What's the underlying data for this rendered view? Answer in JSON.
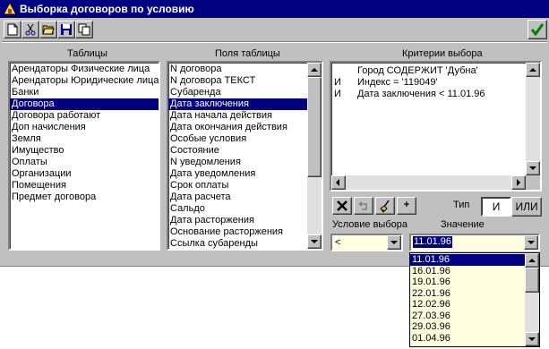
{
  "window": {
    "title": "Выборка договоров по условию"
  },
  "toolbar": {
    "icons": [
      "new-icon",
      "cut-icon",
      "open-icon",
      "save-icon",
      "copy-icon",
      "ok-check-icon"
    ]
  },
  "tables": {
    "header": "Таблицы",
    "items": [
      "Арендаторы Физические лица",
      "Арендаторы Юридические лица",
      "Банки",
      "Договора",
      "Договора работают",
      "Доп начисления",
      "Земля",
      "Имущество",
      "Оплаты",
      "Организации",
      "Помещения",
      "Предмет договора"
    ],
    "selected_index": 3
  },
  "fields": {
    "header": "Поля таблицы",
    "items": [
      "N договора",
      "N договора ТЕКСТ",
      "Субаренда",
      "Дата заключения",
      "Дата начала действия",
      "Дата окончания действия",
      "Особые условия",
      "Состояние",
      "N уведомления",
      "Дата уведомления",
      "Срок оплаты",
      "Дата расчета",
      "Сальдо",
      "Дата расторжения",
      "Основание расторжения",
      "Ссылка субаренды"
    ],
    "selected_index": 3
  },
  "criteria": {
    "header": "Критерии выбора",
    "rows": [
      {
        "op": "",
        "text": "Город СОДЕРЖИТ 'Дубна'"
      },
      {
        "op": "И",
        "text": "Индекс = '119049'"
      },
      {
        "op": "И",
        "text": "Дата заключения < 11.01.96"
      }
    ]
  },
  "type": {
    "label": "Тип",
    "and_label": "И",
    "or_label": "ИЛИ",
    "selected": "И"
  },
  "condition": {
    "label": "Условие выбора",
    "value": "<"
  },
  "value_field": {
    "label": "Значение",
    "current": "11.01.96",
    "options": [
      "11.01.96",
      "16.01.96",
      "19.01.96",
      "22.01.96",
      "12.02.96",
      "27.03.96",
      "29.03.96",
      "01.04.96"
    ],
    "selected_index": 0
  },
  "colors": {
    "titlebar": "#000080",
    "selection": "#000080",
    "face": "#c0c0c0",
    "input_bg": "#ffffe0",
    "ok_check": "#008000"
  }
}
